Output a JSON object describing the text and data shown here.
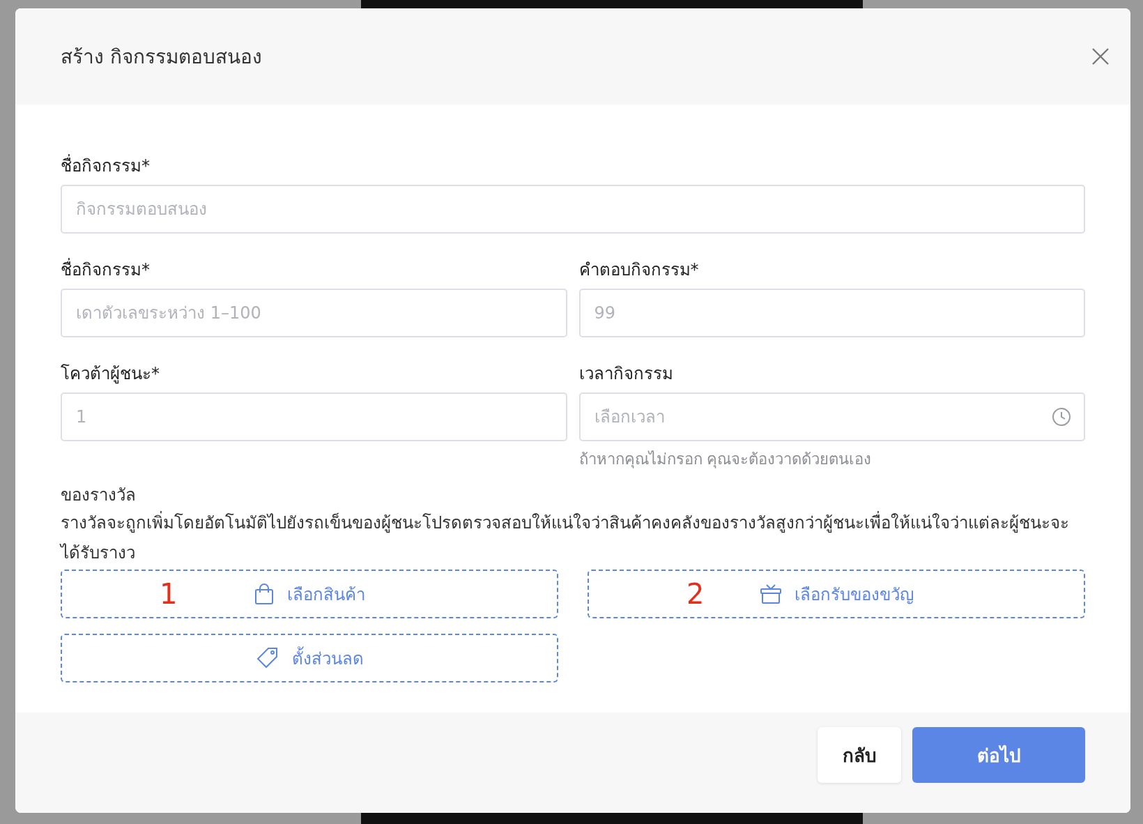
{
  "dialog": {
    "title": "สร้าง กิจกรรมตอบสนอง"
  },
  "fields": [
    {
      "kind": "wide",
      "label": "ชื่อกิจกรรม*",
      "placeholder": "กิจกรรมตอบสนอง"
    },
    {
      "kind": "text",
      "label": "ชื่อกิจกรรม*",
      "placeholder": "เดาตัวเลขระหว่าง 1–100"
    },
    {
      "kind": "text",
      "label": "คำตอบกิจกรรม*",
      "placeholder": "99"
    },
    {
      "kind": "text",
      "label": "โควต้าผู้ชนะ*",
      "placeholder": "1"
    },
    {
      "kind": "time",
      "label": "เวลากิจกรรม",
      "placeholder": "เลือกเวลา",
      "hint": "ถ้าหากคุณไม่กรอก คุณจะต้องวาดด้วยตนเอง"
    }
  ],
  "rewards": {
    "label": "ของรางวัล",
    "description": "รางวัลจะถูกเพิ่มโดยอัตโนมัติไปยังรถเข็นของผู้ชนะโปรดตรวจสอบให้แน่ใจว่าสินค้าคงคลังของรางวัลสูงกว่าผู้ชนะเพื่อให้แน่ใจว่าแต่ละผู้ชนะจะได้รับรางว",
    "options": [
      {
        "kind": "product",
        "marker": "1",
        "label": "เลือกสินค้า"
      },
      {
        "kind": "gift",
        "marker": "2",
        "label": "เลือกรับของขวัญ"
      },
      {
        "kind": "discount",
        "label": "ตั้งส่วนลด"
      }
    ]
  },
  "buttons": [
    {
      "kind": "secondary",
      "label": "กลับ"
    },
    {
      "kind": "primary",
      "label": "ต่อไป"
    }
  ]
}
